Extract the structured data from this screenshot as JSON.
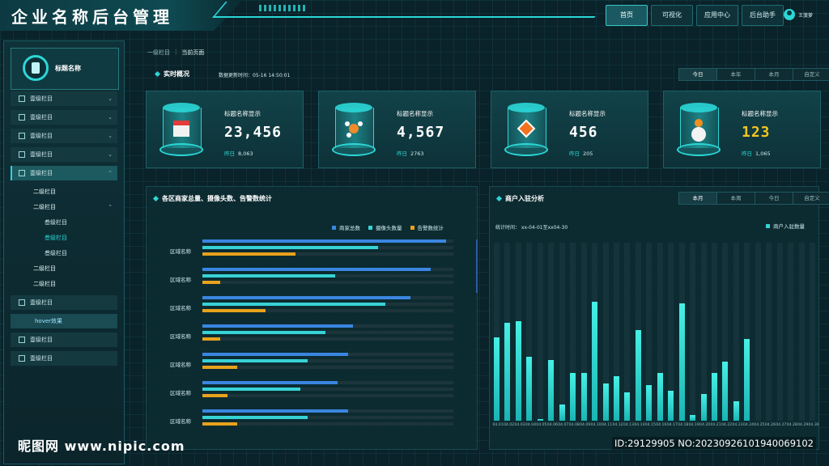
{
  "header": {
    "app_title": "企业名称后台管理",
    "nav": [
      "首页",
      "可视化",
      "应用中心",
      "后台助手"
    ],
    "active_nav": "首页",
    "user_name": "王菠萝"
  },
  "sidebar": {
    "logo_text": "标题名称",
    "items_top": [
      {
        "label": "壹级栏目",
        "icon": "home-icon"
      },
      {
        "label": "壹级栏目",
        "icon": "toggle-icon"
      },
      {
        "label": "壹级栏目",
        "icon": "document-icon"
      },
      {
        "label": "壹级栏目",
        "icon": "lock-icon"
      },
      {
        "label": "壹级栏目",
        "icon": "chart-icon"
      }
    ],
    "sub_l2_a": "二级栏目",
    "sub_l2_b": "二级栏目",
    "sub_l3": [
      "叁级栏目",
      "叁级栏目",
      "叁级栏目"
    ],
    "sub_l2_c": "二级栏目",
    "sub_l2_d": "二级栏目",
    "items_bottom": [
      "壹级栏目",
      "hover效果",
      "壹级栏目",
      "壹级栏目"
    ]
  },
  "breadcrumb": {
    "level1": "一级栏目",
    "current": "当前页面"
  },
  "realtime": {
    "title": "实时概况",
    "update_time": "数据更新时间：05-16 14:50:01",
    "ranges": [
      "今日",
      "本年",
      "本月",
      "自定义"
    ],
    "active_range": "今日",
    "cards": [
      {
        "label": "标题名称显示",
        "value": "23,456",
        "yesterday_label": "昨日",
        "yesterday_value": "8,063",
        "icon": "server-icon"
      },
      {
        "label": "标题名称显示",
        "value": "4,567",
        "yesterday_label": "昨日",
        "yesterday_value": "2763",
        "icon": "network-icon"
      },
      {
        "label": "标题名称显示",
        "value": "456",
        "yesterday_label": "昨日",
        "yesterday_value": "205",
        "icon": "cube-icon"
      },
      {
        "label": "标题名称显示",
        "value": "123",
        "yesterday_label": "昨日",
        "yesterday_value": "1,065",
        "icon": "user-platform-icon"
      }
    ]
  },
  "region_panel": {
    "title": "各区商家总量、摄像头数、告警数统计",
    "legend": [
      {
        "name": "商家总数",
        "color": "#3a86e0"
      },
      {
        "name": "摄像头数量",
        "color": "#37d2d6"
      },
      {
        "name": "告警数统计",
        "color": "#e8a21c"
      }
    ],
    "region_label": "区域名称"
  },
  "merchant_panel": {
    "title": "商户入驻分析",
    "ranges": [
      "本月",
      "本周",
      "今日",
      "自定义"
    ],
    "active_range": "本月",
    "stat_time": "统计时间：  xx-04-01至xx04-30",
    "legend": "商户入驻数量",
    "legend_color": "#37d2d6"
  },
  "chart_data": [
    {
      "type": "bar",
      "orientation": "horizontal",
      "title": "各区商家总量、摄像头数、告警数统计",
      "categories": [
        "区域名称",
        "区域名称",
        "区域名称",
        "区域名称",
        "区域名称",
        "区域名称",
        "区域名称"
      ],
      "xlim": [
        0,
        100
      ],
      "series": [
        {
          "name": "商家总数",
          "values": [
            97,
            91,
            83,
            60,
            58,
            54,
            58
          ]
        },
        {
          "name": "摄像头数量",
          "values": [
            70,
            53,
            73,
            49,
            42,
            39,
            42
          ]
        },
        {
          "name": "告警数统计",
          "values": [
            37,
            7,
            25,
            7,
            14,
            10,
            14
          ]
        }
      ]
    },
    {
      "type": "bar",
      "title": "商户入驻分析",
      "categories": [
        "04.01",
        "04.02",
        "04.03",
        "04.04",
        "04.05",
        "04.06",
        "04.07",
        "04.08",
        "04.09",
        "04.10",
        "04.11",
        "04.12",
        "04.13",
        "04.14",
        "04.15",
        "04.16",
        "04.17",
        "04.18",
        "04.19",
        "04.20",
        "04.21",
        "04.22",
        "04.23",
        "04.24",
        "04.25",
        "04.26",
        "04.27",
        "04.28",
        "04.29",
        "04.30"
      ],
      "ylim": [
        0,
        100
      ],
      "series": [
        {
          "name": "商户入驻数量",
          "values": [
            47,
            55,
            56,
            36,
            1,
            34,
            9,
            27,
            27,
            67,
            21,
            25,
            16,
            51,
            20,
            27,
            17,
            66,
            3,
            15,
            27,
            33,
            11,
            46,
            0,
            0,
            0,
            0,
            0,
            0
          ]
        }
      ]
    }
  ],
  "watermark": {
    "left": "昵图网 www.nipic.com",
    "right": "ID:29129905 NO:20230926101940069102"
  }
}
